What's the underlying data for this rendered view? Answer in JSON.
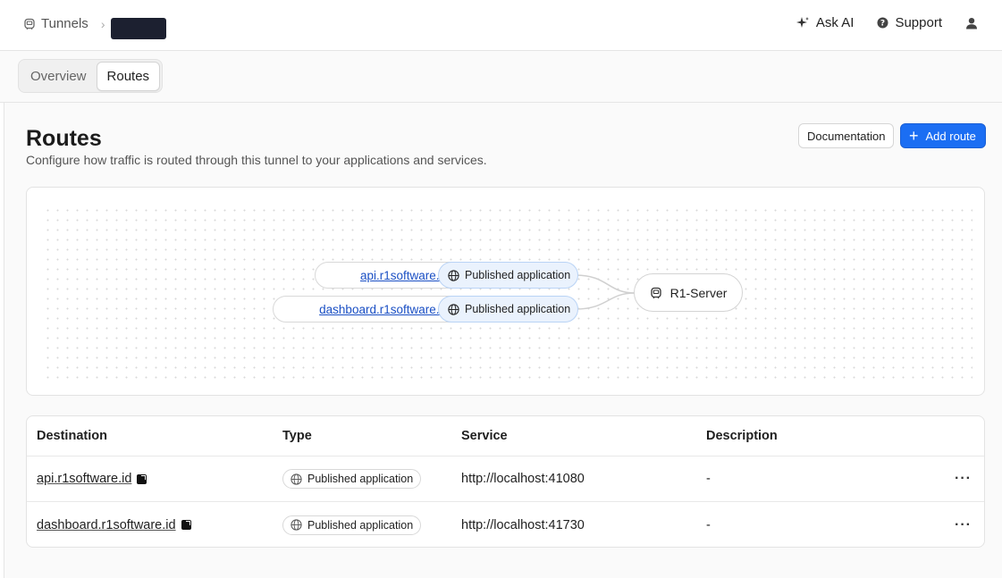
{
  "breadcrumb": {
    "root": "Tunnels",
    "icon": "tunnel-icon",
    "current": ""
  },
  "header": {
    "ask_ai": {
      "label": "Ask AI",
      "icon": "sparkle-icon"
    },
    "support": {
      "label": "Support",
      "icon": "help-circle-icon"
    },
    "user": {
      "icon": "user-icon"
    }
  },
  "tabs": [
    {
      "label": "Overview",
      "active": false
    },
    {
      "label": "Routes",
      "active": true
    }
  ],
  "page": {
    "title": "Routes",
    "subtitle": "Configure how traffic is routed through this tunnel to your applications and services.",
    "documentation_label": "Documentation",
    "add_route_label": "Add route",
    "accent_color": "#1b6ef3"
  },
  "diagram": {
    "routes": [
      {
        "hostname": "api.r1software.id",
        "type": "Published application"
      },
      {
        "hostname": "dashboard.r1software.id",
        "type": "Published application"
      }
    ],
    "server": {
      "name": "R1-Server",
      "icon": "tunnel-icon"
    }
  },
  "table": {
    "columns": [
      "Destination",
      "Type",
      "Service",
      "Description"
    ],
    "rows": [
      {
        "destination": "api.r1software.id",
        "type": "Published application",
        "service": "http://localhost:41080",
        "description": "-",
        "actions": "···"
      },
      {
        "destination": "dashboard.r1software.id",
        "type": "Published application",
        "service": "http://localhost:41730",
        "description": "-",
        "actions": "···"
      }
    ]
  }
}
